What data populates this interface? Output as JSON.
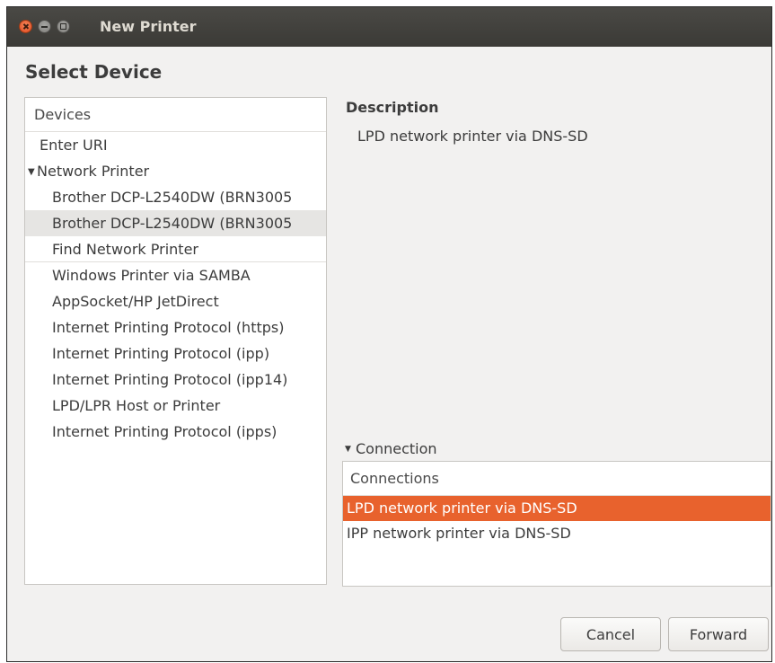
{
  "window": {
    "title": "New Printer",
    "controls": {
      "close": "close-icon",
      "minimize": "minimize-icon",
      "maximize": "maximize-icon"
    }
  },
  "heading": "Select Device",
  "devices": {
    "header": "Devices",
    "items": [
      {
        "label": "Enter URI"
      },
      {
        "label": "Network Printer"
      },
      {
        "label": "Brother DCP-L2540DW (BRN3005"
      },
      {
        "label": "Brother DCP-L2540DW (BRN3005"
      },
      {
        "label": "Find Network Printer"
      },
      {
        "label": "Windows Printer via SAMBA"
      },
      {
        "label": "AppSocket/HP JetDirect"
      },
      {
        "label": "Internet Printing Protocol (https)"
      },
      {
        "label": "Internet Printing Protocol (ipp)"
      },
      {
        "label": "Internet Printing Protocol (ipp14)"
      },
      {
        "label": "LPD/LPR Host or Printer"
      },
      {
        "label": "Internet Printing Protocol (ipps)"
      }
    ],
    "selected_index": 3
  },
  "description": {
    "label": "Description",
    "text": "LPD network printer via DNS-SD"
  },
  "connection": {
    "expander_label": "Connection",
    "header": "Connections",
    "items": [
      {
        "label": "LPD network printer via DNS-SD"
      },
      {
        "label": "IPP network printer via DNS-SD"
      }
    ],
    "selected_index": 0
  },
  "buttons": {
    "cancel": "Cancel",
    "forward": "Forward"
  },
  "colors": {
    "selection_accent": "#e8622d",
    "titlebar": "#3c3b37"
  }
}
